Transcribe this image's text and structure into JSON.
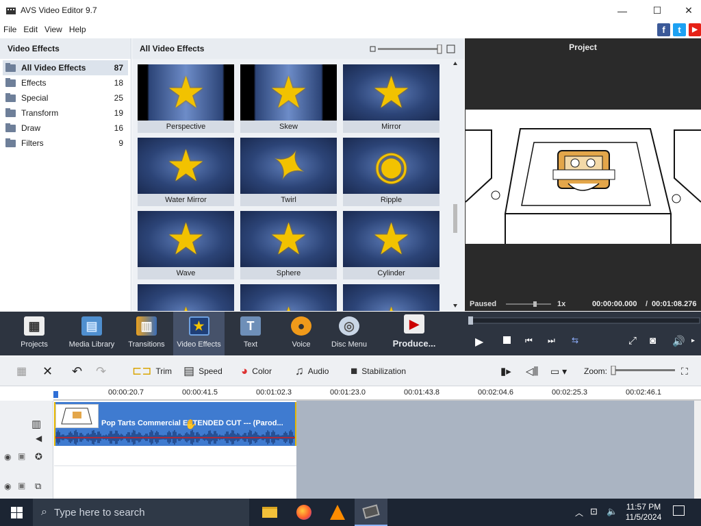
{
  "window": {
    "title": "AVS Video Editor 9.7",
    "minimize": "—",
    "maximize": "☐",
    "close": "✕"
  },
  "menu": [
    "File",
    "Edit",
    "View",
    "Help"
  ],
  "social": {
    "facebook": "f",
    "twitter": "t",
    "youtube": "▶"
  },
  "left_panel": {
    "header": "Video Effects",
    "categories": [
      {
        "label": "All Video Effects",
        "count": "87"
      },
      {
        "label": "Effects",
        "count": "18"
      },
      {
        "label": "Special",
        "count": "25"
      },
      {
        "label": "Transform",
        "count": "19"
      },
      {
        "label": "Draw",
        "count": "16"
      },
      {
        "label": "Filters",
        "count": "9"
      }
    ]
  },
  "effects_panel": {
    "header": "All Video Effects",
    "effects": [
      "Perspective",
      "Skew",
      "Mirror",
      "Water Mirror",
      "Twirl",
      "Ripple",
      "Wave",
      "Sphere",
      "Cylinder"
    ]
  },
  "preview": {
    "header": "Project",
    "status": "Paused",
    "speed": "1x",
    "time_current": "00:00:00.000",
    "time_separator": "/",
    "time_total": "00:01:08.276"
  },
  "toolbar": {
    "projects": "Projects",
    "media_library": "Media Library",
    "transitions": "Transitions",
    "video_effects": "Video Effects",
    "text": "Text",
    "voice": "Voice",
    "disc_menu": "Disc Menu",
    "produce": "Produce..."
  },
  "edit_toolbar": {
    "trim": "Trim",
    "speed": "Speed",
    "color": "Color",
    "audio": "Audio",
    "stabilization": "Stabilization",
    "zoom": "Zoom:"
  },
  "timeline": {
    "ticks": [
      "00:00:20.7",
      "00:00:41.5",
      "00:01:02.3",
      "00:01:23.0",
      "00:01:43.8",
      "00:02:04.6",
      "00:02:25.3",
      "00:02:46.1"
    ],
    "clip_title": "Pop Tarts Commercial EXTENDED CUT --- (Parod..."
  },
  "taskbar": {
    "search_placeholder": "Type here to search",
    "time": "11:57 PM",
    "date": "11/5/2024"
  },
  "colors": {
    "accent": "#3f7bd0",
    "dark_toolbar": "#2d3440",
    "clip_border": "#e6b800",
    "star": "#f2c200"
  }
}
